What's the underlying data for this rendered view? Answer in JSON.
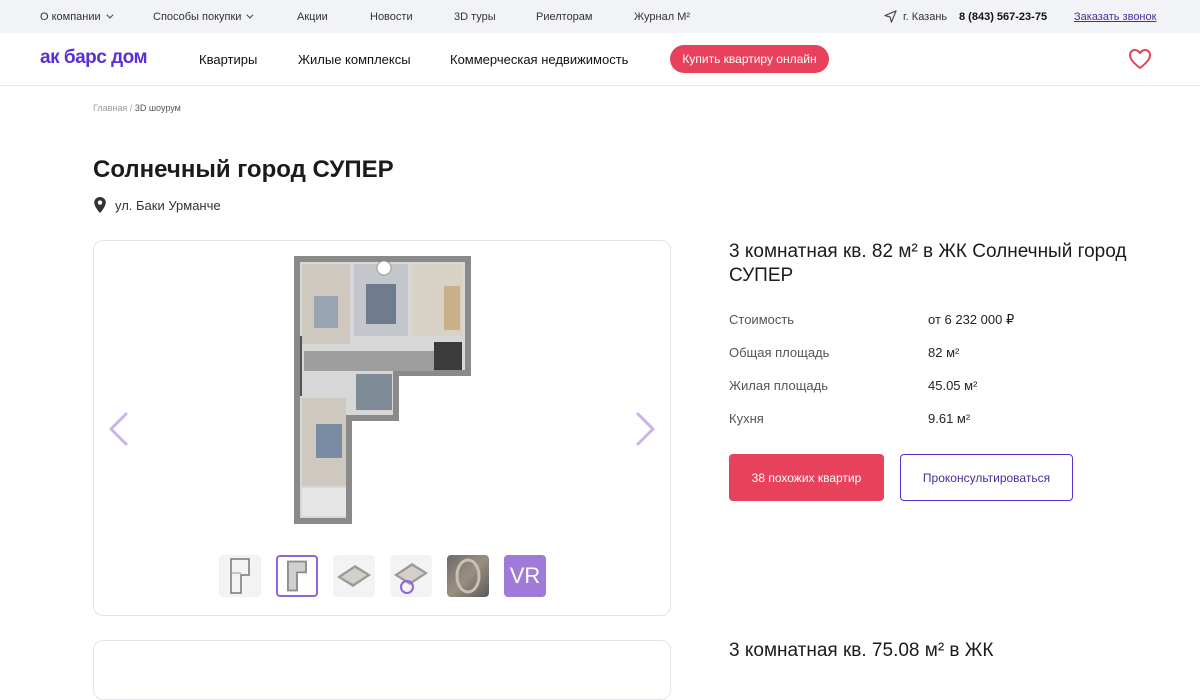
{
  "topbar": {
    "items": [
      "О компании",
      "Способы покупки",
      "Акции",
      "Новости",
      "3D туры",
      "Риелторам",
      "Журнал М²"
    ],
    "city": "г. Казань",
    "phone": "8 (843) 567-23-75",
    "callback": "Заказать звонок"
  },
  "header": {
    "logo": "ак барс дом",
    "nav": [
      "Квартиры",
      "Жилые комплексы",
      "Коммерческая недвижимость"
    ],
    "buy_button": "Купить квартиру онлайн"
  },
  "breadcrumb": {
    "home": "Главная",
    "separator": "/",
    "current": "3D шоурум"
  },
  "page": {
    "title": "Солнечный город СУПЕР",
    "address": "ул. Баки Урманче"
  },
  "gallery": {
    "thumbnails": [
      "plan-2d",
      "plan-3d",
      "view-3d-a",
      "view-3d-b",
      "photo-interior",
      "vr"
    ],
    "vr_label": "VR"
  },
  "listing": {
    "title": "3 комнатная кв. 82 м² в ЖК Солнечный город СУПЕР",
    "rows": [
      {
        "label": "Стоимость",
        "value": "от 6 232 000 ₽"
      },
      {
        "label": "Общая площадь",
        "value": "82 м²"
      },
      {
        "label": "Жилая площадь",
        "value": "45.05 м²"
      },
      {
        "label": "Кухня",
        "value": "9.61 м²"
      }
    ],
    "similar_button": "38 похожих квартир",
    "consult_button": "Проконсультироваться"
  },
  "listing2": {
    "title": "3 комнатная кв. 75.08 м² в ЖК"
  },
  "colors": {
    "brand": "#5a2fd4",
    "accent": "#e8415b",
    "arrow": "#c9b3ee"
  }
}
